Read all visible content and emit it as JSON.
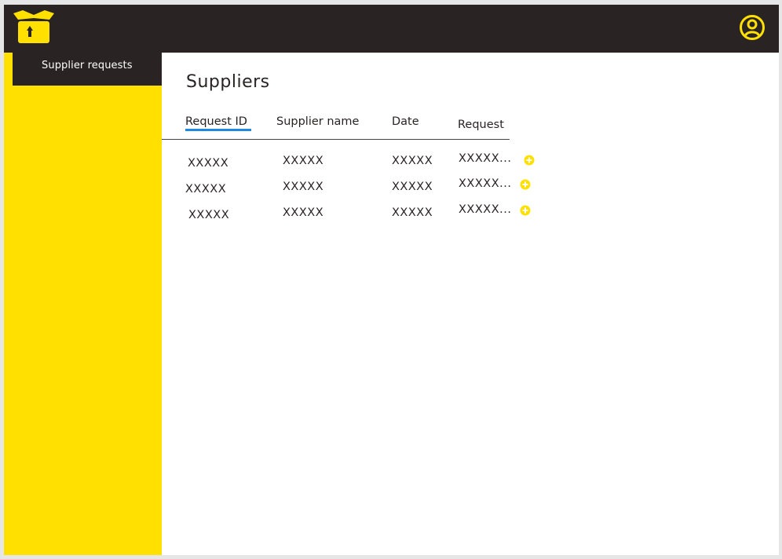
{
  "header": {
    "logo_icon": "box-upload-icon",
    "user_icon": "user-circle-icon"
  },
  "sidebar": {
    "items": [
      {
        "label": "Supplier requests",
        "active": true
      }
    ]
  },
  "main": {
    "title": "Suppliers",
    "table": {
      "columns": [
        "Request ID",
        "Supplier name",
        "Date",
        "Request"
      ],
      "rows": [
        [
          "XXXXX",
          "XXXXX",
          "XXXXX",
          "XXXXX..."
        ],
        [
          "XXXXX",
          "XXXXX",
          "XXXXX",
          "XXXXX..."
        ],
        [
          "XXXXX",
          "XXXXX",
          "XXXXX",
          "XXXXX..."
        ]
      ],
      "row_action_icon": "plus-circle-icon"
    }
  },
  "colors": {
    "topbar": "#2a2324",
    "accent": "#ffe000",
    "sort_underline": "#1e88e5"
  }
}
